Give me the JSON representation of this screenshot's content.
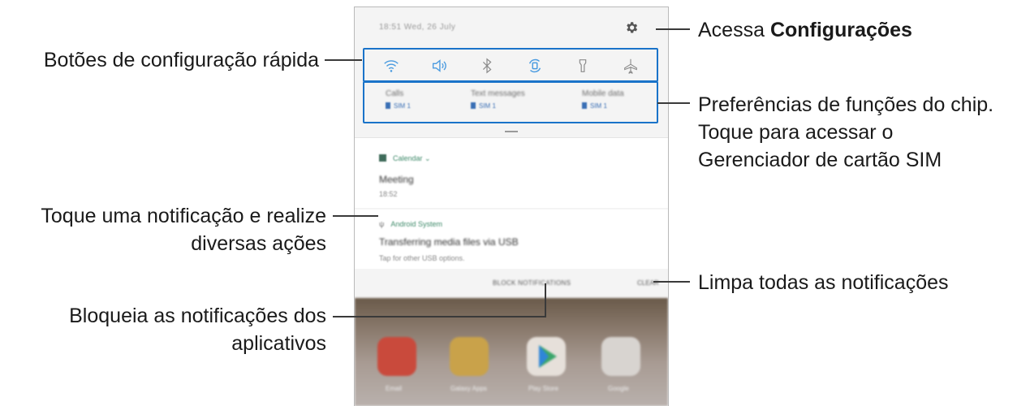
{
  "phone": {
    "status": {
      "datetime": "18:51  Wed, 26 July"
    },
    "quick_settings": [
      "wifi-icon",
      "sound-icon",
      "bluetooth-icon",
      "auto-rotate-icon",
      "flashlight-icon",
      "airplane-mode-icon"
    ],
    "sim": [
      {
        "title": "Calls",
        "sim": "SIM 1"
      },
      {
        "title": "Text messages",
        "sim": "SIM 1"
      },
      {
        "title": "Mobile data",
        "sim": "SIM 1"
      }
    ],
    "notification1": {
      "app": "Calendar",
      "title": "Meeting",
      "time": "18:52"
    },
    "notification2": {
      "app": "Android System",
      "title": "Transferring media files via USB",
      "text": "Tap for other USB options."
    },
    "actions": {
      "block": "BLOCK NOTIFICATIONS",
      "clear": "CLEAR"
    },
    "home_apps": [
      "Email",
      "Galaxy Apps",
      "Play Store",
      "Google"
    ]
  },
  "callouts": {
    "settings_prefix": "Acessa ",
    "settings_bold": "Configurações",
    "quick": "Botões de configuração rápida",
    "sim_line1": "Preferências de funções do chip.",
    "sim_line2": "Toque para acessar o",
    "sim_line3": "Gerenciador de cartão SIM",
    "notif_line1": "Toque uma notificação e realize",
    "notif_line2": "diversas ações",
    "clear": "Limpa todas as notificações",
    "block_line1": "Bloqueia as notificações dos",
    "block_line2": "aplicativos"
  },
  "colors": {
    "highlight": "#1a73c9"
  }
}
